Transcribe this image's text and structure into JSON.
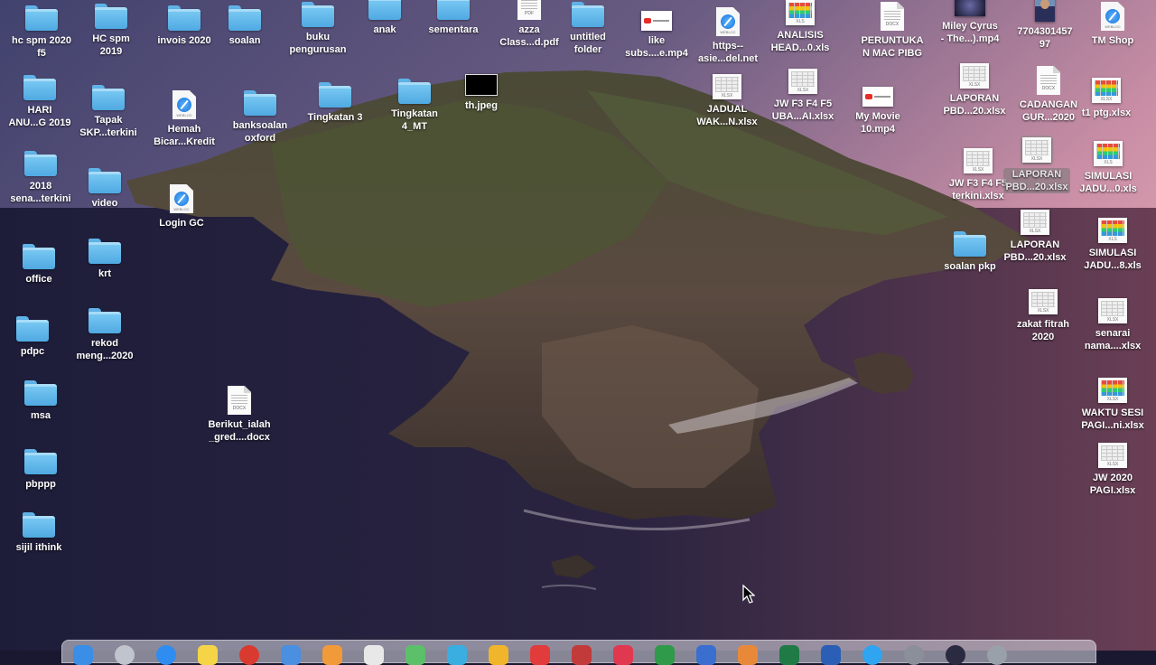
{
  "desktop": {
    "icons": [
      {
        "label": "hc spm 2020\nf5",
        "kind": "folder"
      },
      {
        "label": "HC spm\n2019",
        "kind": "folder"
      },
      {
        "label": "invois 2020",
        "kind": "folder"
      },
      {
        "label": "soalan",
        "kind": "folder"
      },
      {
        "label": "buku\npengurusan",
        "kind": "folder"
      },
      {
        "label": "anak",
        "kind": "folder"
      },
      {
        "label": "sementara",
        "kind": "folder"
      },
      {
        "label": "azza\nClass...d.pdf",
        "kind": "doc",
        "tag": "PDF"
      },
      {
        "label": "untitled\nfolder",
        "kind": "folder"
      },
      {
        "label": "like\nsubs....e.mp4",
        "kind": "video"
      },
      {
        "label": "https--\nasie...del.net",
        "kind": "webloc",
        "tag": "WEBLOC"
      },
      {
        "label": "ANALISIS\nHEAD...0.xls",
        "kind": "sheet-colored",
        "tag": "XLS"
      },
      {
        "label": "PERUNTUKA\nN MAC PIBG",
        "kind": "doc",
        "tag": "DOCX"
      },
      {
        "label": "Miley Cyrus\n- The...).mp4",
        "kind": "dark"
      },
      {
        "label": "7704301457\n97",
        "kind": "person"
      },
      {
        "label": "TM Shop",
        "kind": "webloc",
        "tag": "WEBLOC"
      },
      {
        "label": "HARI\nANU...G 2019",
        "kind": "folder"
      },
      {
        "label": "Tapak\nSKP...terkini",
        "kind": "folder"
      },
      {
        "label": "Hemah\nBicar...Kredit",
        "kind": "webloc",
        "tag": "WEBLOC"
      },
      {
        "label": "banksoalan\noxford",
        "kind": "folder"
      },
      {
        "label": "Tingkatan 3",
        "kind": "folder"
      },
      {
        "label": "Tingkatan\n4_MT",
        "kind": "folder"
      },
      {
        "label": "th.jpeg",
        "kind": "black"
      },
      {
        "label": "JADUAL\nWAK...N.xlsx",
        "kind": "sheet",
        "tag": "XLSX"
      },
      {
        "label": "JW F3 F4 F5\nUBA...AI.xlsx",
        "kind": "sheet",
        "tag": "XLSX"
      },
      {
        "label": "My Movie\n10.mp4",
        "kind": "video"
      },
      {
        "label": "LAPORAN\nPBD...20.xlsx",
        "kind": "sheet",
        "tag": "XLSX"
      },
      {
        "label": "CADANGAN\nGUR...2020",
        "kind": "doc",
        "tag": "DOCX"
      },
      {
        "label": "t1 ptg.xlsx",
        "kind": "sheet-colored",
        "tag": "XLSX"
      },
      {
        "label": "2018\nsena...terkini",
        "kind": "folder"
      },
      {
        "label": "video",
        "kind": "folder"
      },
      {
        "label": "Login GC",
        "kind": "webloc",
        "tag": "WEBLOC"
      },
      {
        "label": "JW F3 F4 F5\nterkini.xlsx",
        "kind": "sheet",
        "tag": "XLSX"
      },
      {
        "label": "LAPORAN\nPBD...20.xlsx",
        "kind": "sheet",
        "tag": "XLSX",
        "selected": true
      },
      {
        "label": "SIMULASI\nJADU...0.xls",
        "kind": "sheet-colored",
        "tag": "XLS"
      },
      {
        "label": "office",
        "kind": "folder"
      },
      {
        "label": "krt",
        "kind": "folder"
      },
      {
        "label": "soalan pkp",
        "kind": "folder"
      },
      {
        "label": "LAPORAN\nPBD...20.xlsx",
        "kind": "sheet",
        "tag": "XLSX"
      },
      {
        "label": "SIMULASI\nJADU...8.xls",
        "kind": "sheet-colored",
        "tag": "XLS"
      },
      {
        "label": "zakat fitrah\n2020",
        "kind": "sheet",
        "tag": "XLSX"
      },
      {
        "label": "senarai\nnama....xlsx",
        "kind": "sheet",
        "tag": "XLSX"
      },
      {
        "label": "pdpc",
        "kind": "folder"
      },
      {
        "label": "rekod\nmeng...2020",
        "kind": "folder"
      },
      {
        "label": "msa",
        "kind": "folder"
      },
      {
        "label": "Berikut_ialah\n_gred....docx",
        "kind": "doc",
        "tag": "DOCX"
      },
      {
        "label": "WAKTU SESI\nPAGI...ni.xlsx",
        "kind": "sheet-colored",
        "tag": "XLSX"
      },
      {
        "label": "pbppp",
        "kind": "folder"
      },
      {
        "label": "JW 2020\nPAGI.xlsx",
        "kind": "sheet",
        "tag": "XLSX"
      },
      {
        "label": "sijil ithink",
        "kind": "folder"
      }
    ]
  },
  "dock": {
    "apps": [
      {
        "icon": "finder-icon",
        "color": "#3a8ee6"
      },
      {
        "icon": "launchpad-icon",
        "color": "#c0c4cc"
      },
      {
        "icon": "safari-icon",
        "color": "#2f8cf0"
      },
      {
        "icon": "notes-icon",
        "color": "#f5d547"
      },
      {
        "icon": "chrome-icon",
        "color": "#d93a2f"
      },
      {
        "icon": "mail-icon",
        "color": "#4a8fe0"
      },
      {
        "icon": "photos-icon",
        "color": "#f09a3a"
      },
      {
        "icon": "contacts-icon",
        "color": "#e8e8e8"
      },
      {
        "icon": "maps-icon",
        "color": "#5cbf6a"
      },
      {
        "icon": "facetime-icon",
        "color": "#3aaee0"
      },
      {
        "icon": "messages-icon",
        "color": "#f0b52a"
      },
      {
        "icon": "calendar-icon",
        "color": "#e23b3b"
      },
      {
        "icon": "reminders-icon",
        "color": "#c23a3a"
      },
      {
        "icon": "itunes-icon",
        "color": "#e0384f"
      },
      {
        "icon": "numbers-icon",
        "color": "#2f9a4a"
      },
      {
        "icon": "keynote-icon",
        "color": "#3a6fd0"
      },
      {
        "icon": "pages-icon",
        "color": "#e8893a"
      },
      {
        "icon": "excel-icon",
        "color": "#1f7a45"
      },
      {
        "icon": "word-icon",
        "color": "#2b5fb5"
      },
      {
        "icon": "app-store-icon",
        "color": "#2fa4f0"
      },
      {
        "icon": "system-preferences-icon",
        "color": "#8a8f99"
      },
      {
        "icon": "quicktime-icon",
        "color": "#2a2a40"
      },
      {
        "icon": "trash-icon",
        "color": "#9aa0aa"
      }
    ]
  }
}
